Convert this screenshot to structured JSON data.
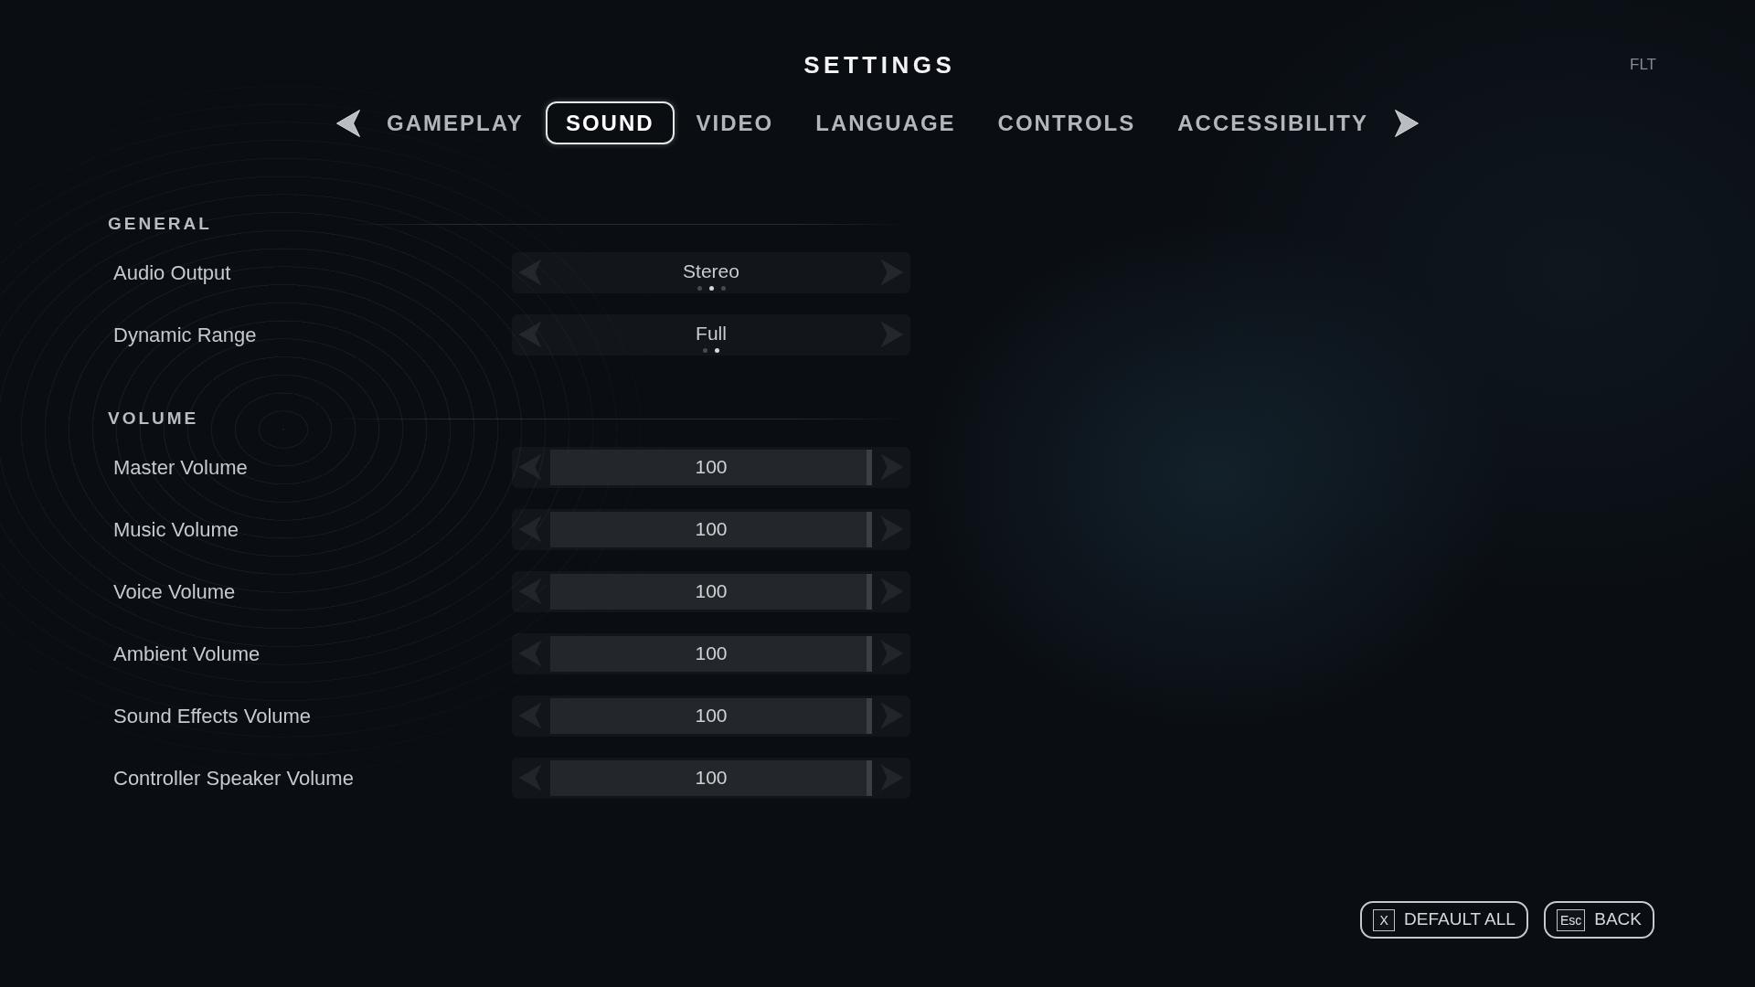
{
  "title": "SETTINGS",
  "corner_label": "FLT",
  "tabs": [
    {
      "label": "GAMEPLAY",
      "selected": false
    },
    {
      "label": "SOUND",
      "selected": true
    },
    {
      "label": "VIDEO",
      "selected": false
    },
    {
      "label": "LANGUAGE",
      "selected": false
    },
    {
      "label": "CONTROLS",
      "selected": false
    },
    {
      "label": "ACCESSIBILITY",
      "selected": false
    }
  ],
  "sections": [
    {
      "heading": "GENERAL",
      "settings": [
        {
          "kind": "selector",
          "label": "Audio Output",
          "value": "Stereo",
          "dots": [
            {
              "selected": false
            },
            {
              "selected": true
            },
            {
              "selected": false
            }
          ]
        },
        {
          "kind": "selector",
          "label": "Dynamic Range",
          "value": "Full",
          "dots": [
            {
              "selected": false
            },
            {
              "selected": true
            }
          ]
        }
      ]
    },
    {
      "heading": "VOLUME",
      "settings": [
        {
          "kind": "slider",
          "label": "Master Volume",
          "value": "100",
          "level": 1
        },
        {
          "kind": "slider",
          "label": "Music Volume",
          "value": "100",
          "level": 1
        },
        {
          "kind": "slider",
          "label": "Voice Volume",
          "value": "100",
          "level": 1
        },
        {
          "kind": "slider",
          "label": "Ambient Volume",
          "value": "100",
          "level": 1
        },
        {
          "kind": "slider",
          "label": "Sound Effects Volume",
          "value": "100",
          "level": 1
        },
        {
          "kind": "slider",
          "label": "Controller Speaker Volume",
          "value": "100",
          "level": 1
        }
      ]
    }
  ],
  "buttons": [
    {
      "key": "X",
      "label": "DEFAULT ALL"
    },
    {
      "key": "Esc",
      "label": "BACK"
    }
  ]
}
